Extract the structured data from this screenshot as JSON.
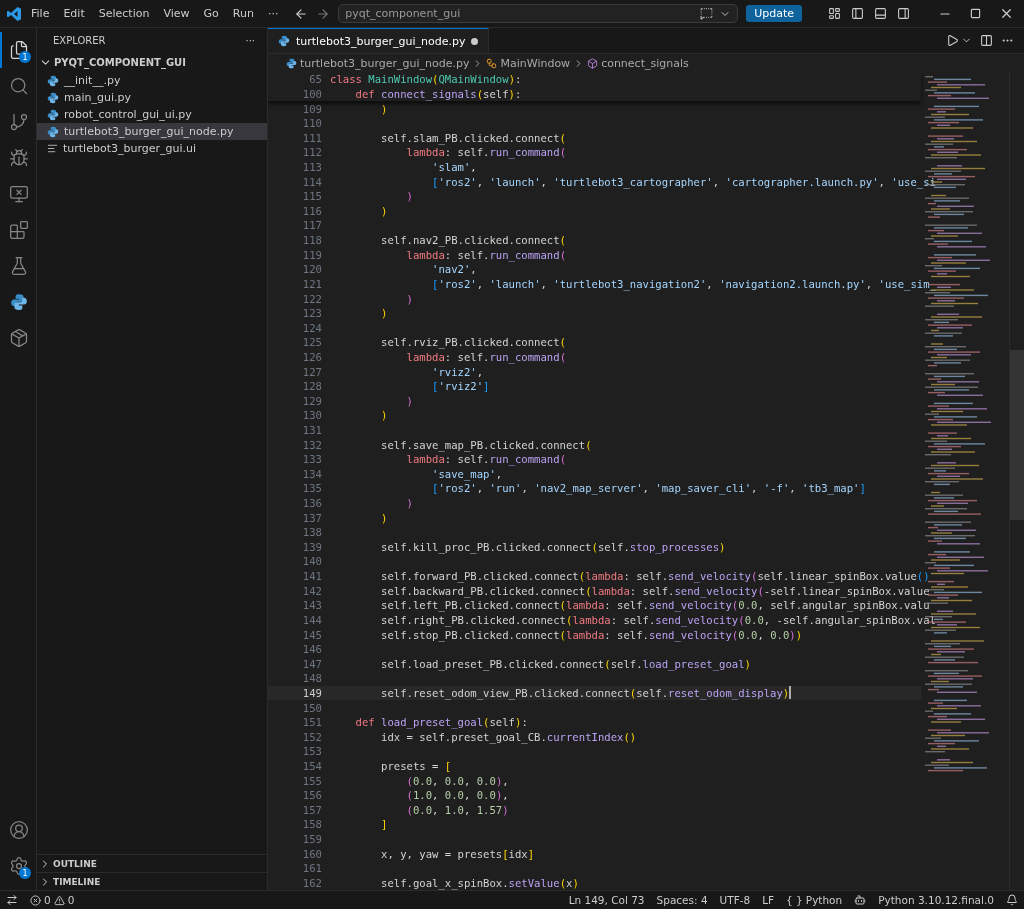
{
  "title_bar": {
    "menus": [
      "File",
      "Edit",
      "Selection",
      "View",
      "Go",
      "Run"
    ],
    "more": "···",
    "search": "pyqt_component_gui",
    "update_button": "Update"
  },
  "activity_bar": {
    "items": [
      {
        "selected": true,
        "badge": "1"
      },
      {
        "selected": false
      },
      {
        "selected": false
      },
      {
        "selected": false
      },
      {
        "selected": false
      },
      {
        "selected": false
      },
      {
        "selected": false
      },
      {
        "selected": false
      },
      {
        "selected": false
      }
    ],
    "settings_badge": "1"
  },
  "sidebar": {
    "title": "EXPLORER",
    "more": "···",
    "folder": {
      "name": "PYQT_COMPONENT_GUI",
      "expanded": true,
      "children": [
        {
          "name": "__init__.py",
          "kind": "python",
          "selected": false
        },
        {
          "name": "main_gui.py",
          "kind": "python",
          "selected": false
        },
        {
          "name": "robot_control_gui_ui.py",
          "kind": "python",
          "selected": false
        },
        {
          "name": "turtlebot3_burger_gui_node.py",
          "kind": "python",
          "selected": true
        },
        {
          "name": "turtlebot3_burger_gui.ui",
          "kind": "text",
          "selected": false
        }
      ]
    },
    "sections": [
      {
        "name": "OUTLINE",
        "expanded": false
      },
      {
        "name": "TIMELINE",
        "expanded": false
      }
    ]
  },
  "editor": {
    "tabs": [
      {
        "label": "turtlebot3_burger_gui_node.py",
        "selected": true,
        "modified": true
      }
    ],
    "breadcrumb": [
      {
        "kind": "file",
        "text": "turtlebot3_burger_gui_node.py"
      },
      {
        "kind": "class",
        "text": "MainWindow"
      },
      {
        "kind": "method",
        "text": "connect_signals"
      }
    ],
    "sticky": [
      {
        "number": "65",
        "tokens": [
          {
            "kind": "keyword",
            "text": "class "
          },
          {
            "kind": "type",
            "text": "MainWindow"
          },
          {
            "kind": "paren1",
            "text": "("
          },
          {
            "kind": "type",
            "text": "QMainWindow"
          },
          {
            "kind": "paren1",
            "text": ")"
          },
          {
            "kind": "plain",
            "text": ":"
          }
        ]
      },
      {
        "number": "100",
        "tokens": [
          {
            "kind": "keyword",
            "text": "    def "
          },
          {
            "kind": "function",
            "text": "connect_signals"
          },
          {
            "kind": "paren1",
            "text": "("
          },
          {
            "kind": "plain",
            "text": "self"
          },
          {
            "kind": "paren1",
            "text": ")"
          },
          {
            "kind": "plain",
            "text": ":"
          }
        ]
      }
    ],
    "lines": [
      {
        "number": "109",
        "current": false,
        "tokens": [
          {
            "kind": "paren1",
            "text": "        )"
          }
        ]
      },
      {
        "number": "110",
        "current": false
      },
      {
        "number": "111",
        "current": false,
        "tokens": [
          {
            "kind": "plain",
            "text": "        self.slam_PB.clicked.connect"
          },
          {
            "kind": "paren1",
            "text": "("
          }
        ]
      },
      {
        "number": "112",
        "current": false,
        "tokens": [
          {
            "kind": "keyword",
            "text": "            lambda"
          },
          {
            "kind": "plain",
            "text": ": self."
          },
          {
            "kind": "function",
            "text": "run_command"
          },
          {
            "kind": "paren2",
            "text": "("
          }
        ]
      },
      {
        "number": "113",
        "current": false,
        "tokens": [
          {
            "kind": "string",
            "text": "                'slam'"
          },
          {
            "kind": "plain",
            "text": ","
          }
        ]
      },
      {
        "number": "114",
        "current": false,
        "tokens": [
          {
            "kind": "paren3",
            "text": "                ["
          },
          {
            "kind": "string",
            "text": "'ros2'"
          },
          {
            "kind": "plain",
            "text": ", "
          },
          {
            "kind": "string",
            "text": "'launch'"
          },
          {
            "kind": "plain",
            "text": ", "
          },
          {
            "kind": "string",
            "text": "'turtlebot3_cartographer'"
          },
          {
            "kind": "plain",
            "text": ", "
          },
          {
            "kind": "string",
            "text": "'cartographer.launch.py'"
          },
          {
            "kind": "plain",
            "text": ", "
          },
          {
            "kind": "string",
            "text": "'use_si"
          }
        ]
      },
      {
        "number": "115",
        "current": false,
        "tokens": [
          {
            "kind": "paren2",
            "text": "            )"
          }
        ]
      },
      {
        "number": "116",
        "current": false,
        "tokens": [
          {
            "kind": "paren1",
            "text": "        )"
          }
        ]
      },
      {
        "number": "117",
        "current": false
      },
      {
        "number": "118",
        "current": false,
        "tokens": [
          {
            "kind": "plain",
            "text": "        self.nav2_PB.clicked.connect"
          },
          {
            "kind": "paren1",
            "text": "("
          }
        ]
      },
      {
        "number": "119",
        "current": false,
        "tokens": [
          {
            "kind": "keyword",
            "text": "            lambda"
          },
          {
            "kind": "plain",
            "text": ": self."
          },
          {
            "kind": "function",
            "text": "run_command"
          },
          {
            "kind": "paren2",
            "text": "("
          }
        ]
      },
      {
        "number": "120",
        "current": false,
        "tokens": [
          {
            "kind": "string",
            "text": "                'nav2'"
          },
          {
            "kind": "plain",
            "text": ","
          }
        ]
      },
      {
        "number": "121",
        "current": false,
        "tokens": [
          {
            "kind": "paren3",
            "text": "                ["
          },
          {
            "kind": "string",
            "text": "'ros2'"
          },
          {
            "kind": "plain",
            "text": ", "
          },
          {
            "kind": "string",
            "text": "'launch'"
          },
          {
            "kind": "plain",
            "text": ", "
          },
          {
            "kind": "string",
            "text": "'turtlebot3_navigation2'"
          },
          {
            "kind": "plain",
            "text": ", "
          },
          {
            "kind": "string",
            "text": "'navigation2.launch.py'"
          },
          {
            "kind": "plain",
            "text": ", "
          },
          {
            "kind": "string",
            "text": "'use_sim_"
          }
        ]
      },
      {
        "number": "122",
        "current": false,
        "tokens": [
          {
            "kind": "paren2",
            "text": "            )"
          }
        ]
      },
      {
        "number": "123",
        "current": false,
        "tokens": [
          {
            "kind": "paren1",
            "text": "        )"
          }
        ]
      },
      {
        "number": "124",
        "current": false
      },
      {
        "number": "125",
        "current": false,
        "tokens": [
          {
            "kind": "plain",
            "text": "        self.rviz_PB.clicked.connect"
          },
          {
            "kind": "paren1",
            "text": "("
          }
        ]
      },
      {
        "number": "126",
        "current": false,
        "tokens": [
          {
            "kind": "keyword",
            "text": "            lambda"
          },
          {
            "kind": "plain",
            "text": ": self."
          },
          {
            "kind": "function",
            "text": "run_command"
          },
          {
            "kind": "paren2",
            "text": "("
          }
        ]
      },
      {
        "number": "127",
        "current": false,
        "tokens": [
          {
            "kind": "string",
            "text": "                'rviz2'"
          },
          {
            "kind": "plain",
            "text": ","
          }
        ]
      },
      {
        "number": "128",
        "current": false,
        "tokens": [
          {
            "kind": "paren3",
            "text": "                ["
          },
          {
            "kind": "string",
            "text": "'rviz2'"
          },
          {
            "kind": "paren3",
            "text": "]"
          }
        ]
      },
      {
        "number": "129",
        "current": false,
        "tokens": [
          {
            "kind": "paren2",
            "text": "            )"
          }
        ]
      },
      {
        "number": "130",
        "current": false,
        "tokens": [
          {
            "kind": "paren1",
            "text": "        )"
          }
        ]
      },
      {
        "number": "131",
        "current": false
      },
      {
        "number": "132",
        "current": false,
        "tokens": [
          {
            "kind": "plain",
            "text": "        self.save_map_PB.clicked.connect"
          },
          {
            "kind": "paren1",
            "text": "("
          }
        ]
      },
      {
        "number": "133",
        "current": false,
        "tokens": [
          {
            "kind": "keyword",
            "text": "            lambda"
          },
          {
            "kind": "plain",
            "text": ": self."
          },
          {
            "kind": "function",
            "text": "run_command"
          },
          {
            "kind": "paren2",
            "text": "("
          }
        ]
      },
      {
        "number": "134",
        "current": false,
        "tokens": [
          {
            "kind": "string",
            "text": "                'save_map'"
          },
          {
            "kind": "plain",
            "text": ","
          }
        ]
      },
      {
        "number": "135",
        "current": false,
        "tokens": [
          {
            "kind": "paren3",
            "text": "                ["
          },
          {
            "kind": "string",
            "text": "'ros2'"
          },
          {
            "kind": "plain",
            "text": ", "
          },
          {
            "kind": "string",
            "text": "'run'"
          },
          {
            "kind": "plain",
            "text": ", "
          },
          {
            "kind": "string",
            "text": "'nav2_map_server'"
          },
          {
            "kind": "plain",
            "text": ", "
          },
          {
            "kind": "string",
            "text": "'map_saver_cli'"
          },
          {
            "kind": "plain",
            "text": ", "
          },
          {
            "kind": "string",
            "text": "'-f'"
          },
          {
            "kind": "plain",
            "text": ", "
          },
          {
            "kind": "string",
            "text": "'tb3_map'"
          },
          {
            "kind": "paren3",
            "text": "]"
          }
        ]
      },
      {
        "number": "136",
        "current": false,
        "tokens": [
          {
            "kind": "paren2",
            "text": "            )"
          }
        ]
      },
      {
        "number": "137",
        "current": false,
        "tokens": [
          {
            "kind": "paren1",
            "text": "        )"
          }
        ]
      },
      {
        "number": "138",
        "current": false
      },
      {
        "number": "139",
        "current": false,
        "tokens": [
          {
            "kind": "plain",
            "text": "        self.kill_proc_PB.clicked.connect"
          },
          {
            "kind": "paren1",
            "text": "("
          },
          {
            "kind": "plain",
            "text": "self."
          },
          {
            "kind": "function",
            "text": "stop_processes"
          },
          {
            "kind": "paren1",
            "text": ")"
          }
        ]
      },
      {
        "number": "140",
        "current": false
      },
      {
        "number": "141",
        "current": false,
        "tokens": [
          {
            "kind": "plain",
            "text": "        self.forward_PB.clicked.connect"
          },
          {
            "kind": "paren1",
            "text": "("
          },
          {
            "kind": "keyword",
            "text": "lambda"
          },
          {
            "kind": "plain",
            "text": ": self."
          },
          {
            "kind": "function",
            "text": "send_velocity"
          },
          {
            "kind": "paren2",
            "text": "("
          },
          {
            "kind": "plain",
            "text": "self.linear_spinBox.value"
          },
          {
            "kind": "paren3",
            "text": "()"
          }
        ]
      },
      {
        "number": "142",
        "current": false,
        "tokens": [
          {
            "kind": "plain",
            "text": "        self.backward_PB.clicked.connect"
          },
          {
            "kind": "paren1",
            "text": "("
          },
          {
            "kind": "keyword",
            "text": "lambda"
          },
          {
            "kind": "plain",
            "text": ": self."
          },
          {
            "kind": "function",
            "text": "send_velocity"
          },
          {
            "kind": "paren2",
            "text": "("
          },
          {
            "kind": "plain",
            "text": "-self.linear_spinBox.value"
          }
        ]
      },
      {
        "number": "143",
        "current": false,
        "tokens": [
          {
            "kind": "plain",
            "text": "        self.left_PB.clicked.connect"
          },
          {
            "kind": "paren1",
            "text": "("
          },
          {
            "kind": "keyword",
            "text": "lambda"
          },
          {
            "kind": "plain",
            "text": ": self."
          },
          {
            "kind": "function",
            "text": "send_velocity"
          },
          {
            "kind": "paren2",
            "text": "("
          },
          {
            "kind": "number",
            "text": "0.0"
          },
          {
            "kind": "plain",
            "text": ", self.angular_spinBox.valu"
          }
        ]
      },
      {
        "number": "144",
        "current": false,
        "tokens": [
          {
            "kind": "plain",
            "text": "        self.right_PB.clicked.connect"
          },
          {
            "kind": "paren1",
            "text": "("
          },
          {
            "kind": "keyword",
            "text": "lambda"
          },
          {
            "kind": "plain",
            "text": ": self."
          },
          {
            "kind": "function",
            "text": "send_velocity"
          },
          {
            "kind": "paren2",
            "text": "("
          },
          {
            "kind": "number",
            "text": "0.0"
          },
          {
            "kind": "plain",
            "text": ", -self.angular_spinBox.val"
          }
        ]
      },
      {
        "number": "145",
        "current": false,
        "tokens": [
          {
            "kind": "plain",
            "text": "        self.stop_PB.clicked.connect"
          },
          {
            "kind": "paren1",
            "text": "("
          },
          {
            "kind": "keyword",
            "text": "lambda"
          },
          {
            "kind": "plain",
            "text": ": self."
          },
          {
            "kind": "function",
            "text": "send_velocity"
          },
          {
            "kind": "paren2",
            "text": "("
          },
          {
            "kind": "number",
            "text": "0.0"
          },
          {
            "kind": "plain",
            "text": ", "
          },
          {
            "kind": "number",
            "text": "0.0"
          },
          {
            "kind": "paren2",
            "text": ")"
          },
          {
            "kind": "paren1",
            "text": ")"
          }
        ]
      },
      {
        "number": "146",
        "current": false
      },
      {
        "number": "147",
        "current": false,
        "tokens": [
          {
            "kind": "plain",
            "text": "        self.load_preset_PB.clicked.connect"
          },
          {
            "kind": "paren1",
            "text": "("
          },
          {
            "kind": "plain",
            "text": "self."
          },
          {
            "kind": "function",
            "text": "load_preset_goal"
          },
          {
            "kind": "paren1",
            "text": ")"
          }
        ]
      },
      {
        "number": "148",
        "current": false
      },
      {
        "number": "149",
        "current": true,
        "tokens": [
          {
            "kind": "plain",
            "text": "        self.reset_odom_view_PB.clicked.connect"
          },
          {
            "kind": "paren1",
            "text": "("
          },
          {
            "kind": "plain",
            "text": "self."
          },
          {
            "kind": "function",
            "text": "reset_odom_display"
          },
          {
            "kind": "paren1",
            "text": ")"
          }
        ]
      },
      {
        "number": "150",
        "current": false
      },
      {
        "number": "151",
        "current": false,
        "tokens": [
          {
            "kind": "keyword",
            "text": "    def "
          },
          {
            "kind": "function",
            "text": "load_preset_goal"
          },
          {
            "kind": "paren1",
            "text": "("
          },
          {
            "kind": "plain",
            "text": "self"
          },
          {
            "kind": "paren1",
            "text": ")"
          },
          {
            "kind": "plain",
            "text": ":"
          }
        ]
      },
      {
        "number": "152",
        "current": false,
        "tokens": [
          {
            "kind": "plain",
            "text": "        idx = self.preset_goal_CB."
          },
          {
            "kind": "function",
            "text": "currentIndex"
          },
          {
            "kind": "paren1",
            "text": "()"
          }
        ]
      },
      {
        "number": "153",
        "current": false
      },
      {
        "number": "154",
        "current": false,
        "tokens": [
          {
            "kind": "plain",
            "text": "        presets = "
          },
          {
            "kind": "paren1",
            "text": "["
          }
        ]
      },
      {
        "number": "155",
        "current": false,
        "tokens": [
          {
            "kind": "paren2",
            "text": "            ("
          },
          {
            "kind": "number",
            "text": "0.0"
          },
          {
            "kind": "plain",
            "text": ", "
          },
          {
            "kind": "number",
            "text": "0.0"
          },
          {
            "kind": "plain",
            "text": ", "
          },
          {
            "kind": "number",
            "text": "0.0"
          },
          {
            "kind": "paren2",
            "text": ")"
          },
          {
            "kind": "plain",
            "text": ","
          }
        ]
      },
      {
        "number": "156",
        "current": false,
        "tokens": [
          {
            "kind": "paren2",
            "text": "            ("
          },
          {
            "kind": "number",
            "text": "1.0"
          },
          {
            "kind": "plain",
            "text": ", "
          },
          {
            "kind": "number",
            "text": "0.0"
          },
          {
            "kind": "plain",
            "text": ", "
          },
          {
            "kind": "number",
            "text": "0.0"
          },
          {
            "kind": "paren2",
            "text": ")"
          },
          {
            "kind": "plain",
            "text": ","
          }
        ]
      },
      {
        "number": "157",
        "current": false,
        "tokens": [
          {
            "kind": "paren2",
            "text": "            ("
          },
          {
            "kind": "number",
            "text": "0.0"
          },
          {
            "kind": "plain",
            "text": ", "
          },
          {
            "kind": "number",
            "text": "1.0"
          },
          {
            "kind": "plain",
            "text": ", "
          },
          {
            "kind": "number",
            "text": "1.57"
          },
          {
            "kind": "paren2",
            "text": ")"
          }
        ]
      },
      {
        "number": "158",
        "current": false,
        "tokens": [
          {
            "kind": "paren1",
            "text": "        ]"
          }
        ]
      },
      {
        "number": "159",
        "current": false
      },
      {
        "number": "160",
        "current": false,
        "tokens": [
          {
            "kind": "plain",
            "text": "        x, y, yaw = presets"
          },
          {
            "kind": "paren1",
            "text": "["
          },
          {
            "kind": "plain",
            "text": "idx"
          },
          {
            "kind": "paren1",
            "text": "]"
          }
        ]
      },
      {
        "number": "161",
        "current": false
      },
      {
        "number": "162",
        "current": false,
        "tokens": [
          {
            "kind": "plain",
            "text": "        self.goal_x_spinBox."
          },
          {
            "kind": "function",
            "text": "setValue"
          },
          {
            "kind": "paren1",
            "text": "("
          },
          {
            "kind": "plain",
            "text": "x"
          },
          {
            "kind": "paren1",
            "text": ")"
          }
        ]
      }
    ]
  },
  "status_bar": {
    "errors": "0",
    "warnings": "0",
    "items": [
      "Ln 149, Col 73",
      "Spaces: 4",
      "UTF-8",
      "LF"
    ],
    "language_braces": "{ }",
    "language": "Python",
    "interpreter": "Python 3.10.12.final.0"
  }
}
